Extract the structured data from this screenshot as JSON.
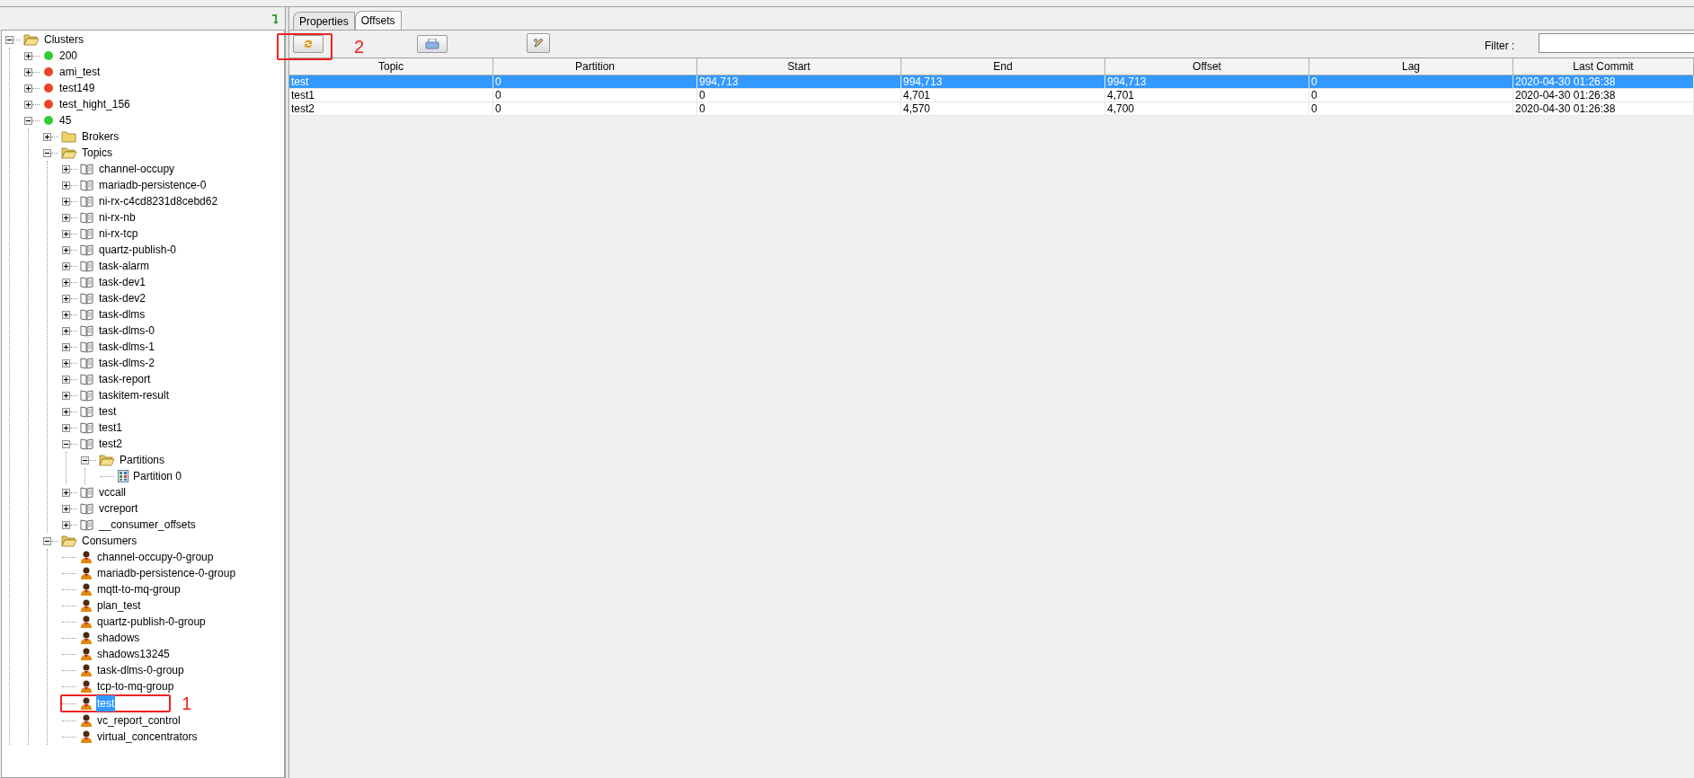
{
  "tree": [
    {
      "kind": "folder",
      "label": "Clusters",
      "expanded": true,
      "selected": false,
      "children": [
        {
          "kind": "cluster",
          "label": "200",
          "color": "#33cc33",
          "expanded": false,
          "selected": false
        },
        {
          "kind": "cluster",
          "label": "ami_test",
          "color": "#ee4422",
          "expanded": false,
          "selected": false
        },
        {
          "kind": "cluster",
          "label": "test149",
          "color": "#ee4422",
          "expanded": false,
          "selected": false
        },
        {
          "kind": "cluster",
          "label": "test_hight_156",
          "color": "#ee4422",
          "expanded": false,
          "selected": false
        },
        {
          "kind": "cluster",
          "label": "45",
          "color": "#33cc33",
          "expanded": true,
          "selected": false,
          "children": [
            {
              "kind": "folder",
              "label": "Brokers",
              "expanded": false,
              "selected": false
            },
            {
              "kind": "folder",
              "label": "Topics",
              "expanded": true,
              "selected": false,
              "children": [
                {
                  "kind": "topic",
                  "label": "channel-occupy",
                  "expanded": false,
                  "selected": false
                },
                {
                  "kind": "topic",
                  "label": "mariadb-persistence-0",
                  "expanded": false,
                  "selected": false
                },
                {
                  "kind": "topic",
                  "label": "ni-rx-c4cd8231d8cebd62",
                  "expanded": false,
                  "selected": false
                },
                {
                  "kind": "topic",
                  "label": "ni-rx-nb",
                  "expanded": false,
                  "selected": false
                },
                {
                  "kind": "topic",
                  "label": "ni-rx-tcp",
                  "expanded": false,
                  "selected": false
                },
                {
                  "kind": "topic",
                  "label": "quartz-publish-0",
                  "expanded": false,
                  "selected": false
                },
                {
                  "kind": "topic",
                  "label": "task-alarm",
                  "expanded": false,
                  "selected": false
                },
                {
                  "kind": "topic",
                  "label": "task-dev1",
                  "expanded": false,
                  "selected": false
                },
                {
                  "kind": "topic",
                  "label": "task-dev2",
                  "expanded": false,
                  "selected": false
                },
                {
                  "kind": "topic",
                  "label": "task-dlms",
                  "expanded": false,
                  "selected": false
                },
                {
                  "kind": "topic",
                  "label": "task-dlms-0",
                  "expanded": false,
                  "selected": false
                },
                {
                  "kind": "topic",
                  "label": "task-dlms-1",
                  "expanded": false,
                  "selected": false
                },
                {
                  "kind": "topic",
                  "label": "task-dlms-2",
                  "expanded": false,
                  "selected": false
                },
                {
                  "kind": "topic",
                  "label": "task-report",
                  "expanded": false,
                  "selected": false
                },
                {
                  "kind": "topic",
                  "label": "taskitem-result",
                  "expanded": false,
                  "selected": false
                },
                {
                  "kind": "topic",
                  "label": "test",
                  "expanded": false,
                  "selected": false
                },
                {
                  "kind": "topic",
                  "label": "test1",
                  "expanded": false,
                  "selected": false
                },
                {
                  "kind": "topic",
                  "label": "test2",
                  "expanded": true,
                  "selected": false,
                  "children": [
                    {
                      "kind": "folder",
                      "label": "Partitions",
                      "expanded": true,
                      "selected": false,
                      "children": [
                        {
                          "kind": "partition",
                          "label": "Partition 0",
                          "selected": false
                        }
                      ]
                    }
                  ]
                },
                {
                  "kind": "topic",
                  "label": "vccall",
                  "expanded": false,
                  "selected": false
                },
                {
                  "kind": "topic",
                  "label": "vcreport",
                  "expanded": false,
                  "selected": false
                },
                {
                  "kind": "topic",
                  "label": "__consumer_offsets",
                  "expanded": false,
                  "selected": false
                }
              ]
            },
            {
              "kind": "folder",
              "label": "Consumers",
              "expanded": true,
              "selected": false,
              "children": [
                {
                  "kind": "consumer",
                  "label": "channel-occupy-0-group",
                  "selected": false
                },
                {
                  "kind": "consumer",
                  "label": "mariadb-persistence-0-group",
                  "selected": false
                },
                {
                  "kind": "consumer",
                  "label": "mqtt-to-mq-group",
                  "selected": false
                },
                {
                  "kind": "consumer",
                  "label": "plan_test",
                  "selected": false
                },
                {
                  "kind": "consumer",
                  "label": "quartz-publish-0-group",
                  "selected": false
                },
                {
                  "kind": "consumer",
                  "label": "shadows",
                  "selected": false
                },
                {
                  "kind": "consumer",
                  "label": "shadows13245",
                  "selected": false
                },
                {
                  "kind": "consumer",
                  "label": "task-dlms-0-group",
                  "selected": false
                },
                {
                  "kind": "consumer",
                  "label": "tcp-to-mq-group",
                  "selected": false
                },
                {
                  "kind": "consumer",
                  "label": "test",
                  "selected": true,
                  "annotation": "1"
                },
                {
                  "kind": "consumer",
                  "label": "vc_report_control",
                  "selected": false
                },
                {
                  "kind": "consumer",
                  "label": "virtual_concentrators",
                  "selected": false
                }
              ]
            }
          ]
        }
      ]
    }
  ],
  "tabs": [
    {
      "label": "Properties",
      "selected": false
    },
    {
      "label": "Offsets",
      "selected": true
    }
  ],
  "toolbar": {
    "refresh_annotation": "2"
  },
  "filter": {
    "label": "Filter :"
  },
  "table": {
    "columns": [
      "Topic",
      "Partition",
      "Start",
      "End",
      "Offset",
      "Lag",
      "Last Commit"
    ],
    "rows": [
      {
        "cells": [
          "test",
          "0",
          "994,713",
          "994,713",
          "994,713",
          "0",
          "2020-04-30 01:26:38"
        ],
        "selected": true
      },
      {
        "cells": [
          "test1",
          "0",
          "0",
          "4,701",
          "4,701",
          "0",
          "2020-04-30 01:26:38"
        ],
        "selected": false
      },
      {
        "cells": [
          "test2",
          "0",
          "0",
          "4,570",
          "4,700",
          "0",
          "2020-04-30 01:26:38"
        ],
        "selected": false
      }
    ]
  }
}
